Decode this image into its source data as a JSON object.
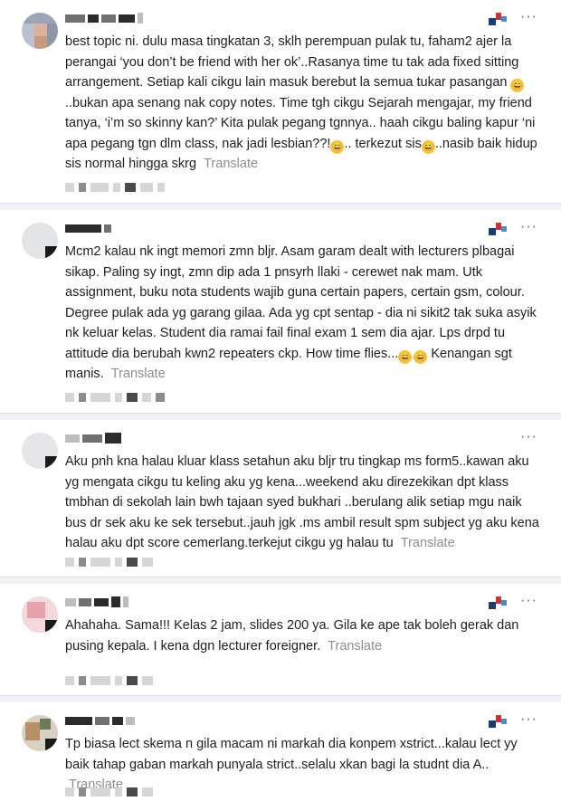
{
  "translate_label": "Translate",
  "more_label": "···",
  "emoji_glyph": "😄",
  "comments": [
    {
      "text_parts": [
        "best topic ni. dulu masa tingkatan 3, sklh perempuan pulak tu, faham2 ajer la perangai ‘you don’t be friend with her ok’..Rasanya time tu tak ada fixed sitting arrangement. Setiap kali cikgu lain masuk berebut la semua tukar pasangan ",
        "..bukan apa senang nak copy notes. Time tgh cikgu Sejarah mengajar, my friend tanya, ‘i’m so skinny kan?’ Kita pulak pegang tgnnya.. haah cikgu baling kapur ‘ni apa pegang tgn dlm class, nak jadi lesbian??!",
        ".. terkezut sis",
        "..nasib baik hidup sis normal hingga skrg"
      ]
    },
    {
      "text_parts": [
        "Mcm2 kalau nk ingt memori zmn bljr. Asam garam dealt with lecturers plbagai sikap. Paling sy ingt, zmn dip ada 1 pnsyrh llaki - cerewet nak mam. Utk assignment, buku nota students wajib guna certain papers, certain gsm, colour. Degree pulak ada yg garang gilaa. Ada yg cpt sentap - dia ni sikit2 tak suka asyik nk keluar kelas. Student dia ramai fail final exam 1 sem dia ajar. Lps drpd tu attitude dia berubah kwn2 repeaters ckp. How time flies...",
        " Kenangan sgt manis."
      ]
    },
    {
      "text_parts": [
        "Aku pnh kna halau kluar klass setahun aku bljr tru tingkap ms form5..kawan aku yg mengata cikgu tu keling aku yg kena...weekend aku direzekikan dpt klass tmbhan di sekolah lain bwh tajaan syed bukhari ..berulang alik setiap mgu naik bus dr sek aku ke sek tersebut..jauh jgk .ms ambil result spm subject yg aku kena halau aku dpt score cemerlang.terkejut cikgu yg halau tu"
      ]
    },
    {
      "text_parts": [
        "Ahahaha. Sama!!! Kelas 2 jam, slides 200 ya. Gila ke ape tak boleh gerak dan pusing kepala. I kena dgn lecturer foreigner."
      ]
    },
    {
      "text_parts": [
        "Tp biasa lect skema n gila macam ni markah dia konpem xstrict...kalau lect yy baik tahap gaban markah punyala strict..selalu xkan bagi la studnt dia A.."
      ]
    }
  ]
}
